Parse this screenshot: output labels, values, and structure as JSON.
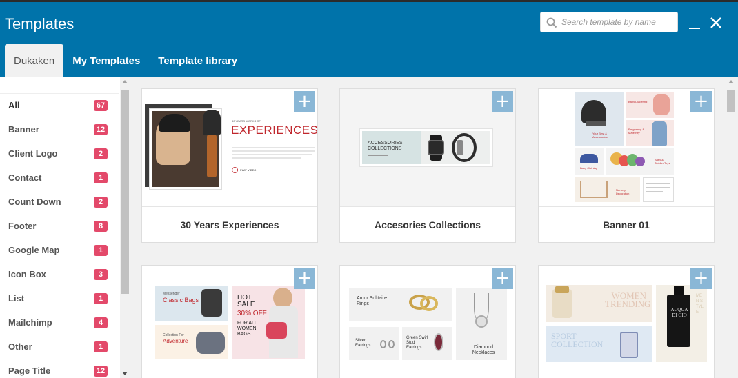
{
  "header": {
    "title": "Templates",
    "search_placeholder": "Search template by name",
    "minimize_icon": "minimize-icon",
    "close_icon": "close-icon"
  },
  "tabs": [
    {
      "label": "Dukaken",
      "active": true
    },
    {
      "label": "My Templates",
      "active": false
    },
    {
      "label": "Template library",
      "active": false
    }
  ],
  "categories": [
    {
      "label": "All",
      "count": "67"
    },
    {
      "label": "Banner",
      "count": "12"
    },
    {
      "label": "Client Logo",
      "count": "2"
    },
    {
      "label": "Contact",
      "count": "1"
    },
    {
      "label": "Count Down",
      "count": "2"
    },
    {
      "label": "Footer",
      "count": "8"
    },
    {
      "label": "Google Map",
      "count": "1"
    },
    {
      "label": "Icon Box",
      "count": "3"
    },
    {
      "label": "List",
      "count": "1"
    },
    {
      "label": "Mailchimp",
      "count": "4"
    },
    {
      "label": "Other",
      "count": "1"
    },
    {
      "label": "Page Title",
      "count": "12"
    }
  ],
  "templates": [
    {
      "name": "30 Years Experiences"
    },
    {
      "name": "Accesories Collections"
    },
    {
      "name": "Banner 01"
    },
    {
      "name": ""
    },
    {
      "name": ""
    },
    {
      "name": ""
    }
  ],
  "thumbs": {
    "t1": {
      "small": "30 YEARS WORKS OF",
      "headline": "EXPERIENCES",
      "cta": "PLAY VIDEO"
    },
    "t2": {
      "headline": "ACCESSORIES COLLECTIONS"
    },
    "t3": {
      "a": "Your Best & Accessories",
      "b": "Baby Diapering",
      "c": "Pregnancy & Maternity",
      "d": "Baby Clothing",
      "e": "Baby & Toddler Toys",
      "f": "Nursery Decoration"
    },
    "t4": {
      "a_small": "Messenger",
      "a_big": "Classic Bags",
      "b_big": "HOT SALE",
      "b_pct": "30% OFF",
      "b_sub": "FOR ALL WOMEN BAGS",
      "c_small": "Collection For",
      "c_big": "Adventure"
    },
    "t5": {
      "a": "Amor Solitaire Rings",
      "b": "Silver Earrings",
      "c": "Green Swirl Stud Earrings",
      "d": "Diamond Necklaces"
    },
    "t6": {
      "a": "WOMEN TRENDING",
      "b": "SPORT COLLECTION",
      "c": "MEN STYLE",
      "d": "ACQUA DI GIO"
    }
  },
  "colors": {
    "header": "#0073aa",
    "badge": "#e3496a",
    "plus": "#8ab7d6",
    "accent_red": "#c0272d"
  }
}
